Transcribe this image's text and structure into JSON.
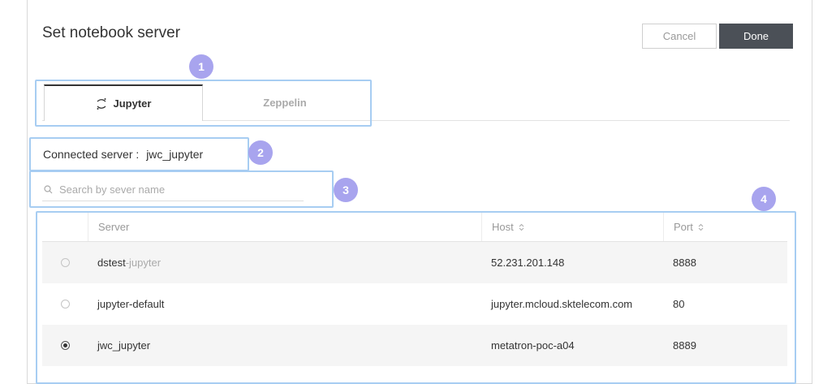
{
  "dialog": {
    "title": "Set notebook server",
    "cancel_label": "Cancel",
    "done_label": "Done"
  },
  "tabs": [
    {
      "label": "Jupyter",
      "active": true,
      "icon": "jupyter-icon"
    },
    {
      "label": "Zeppelin",
      "active": false
    }
  ],
  "connected": {
    "label": "Connected server :",
    "value": "jwc_jupyter"
  },
  "search": {
    "placeholder": "Search by sever name",
    "value": ""
  },
  "table": {
    "columns": [
      "Server",
      "Host",
      "Port"
    ],
    "rows": [
      {
        "server": "dstest",
        "server_suffix": "-jupyter",
        "host": "52.231.201.148",
        "port": "8888",
        "selected": false
      },
      {
        "server": "jupyter-default",
        "server_suffix": "",
        "host": "jupyter.mcloud.sktelecom.com",
        "port": "80",
        "selected": false
      },
      {
        "server": "jwc_jupyter",
        "server_suffix": "",
        "host": "metatron-poc-a04",
        "port": "8889",
        "selected": true
      }
    ]
  },
  "annotations": [
    "1",
    "2",
    "3",
    "4"
  ],
  "colors": {
    "annotation_badge": "#a8a4ee",
    "annotation_outline": "#a7cdf2",
    "done_button": "#4b5057"
  }
}
